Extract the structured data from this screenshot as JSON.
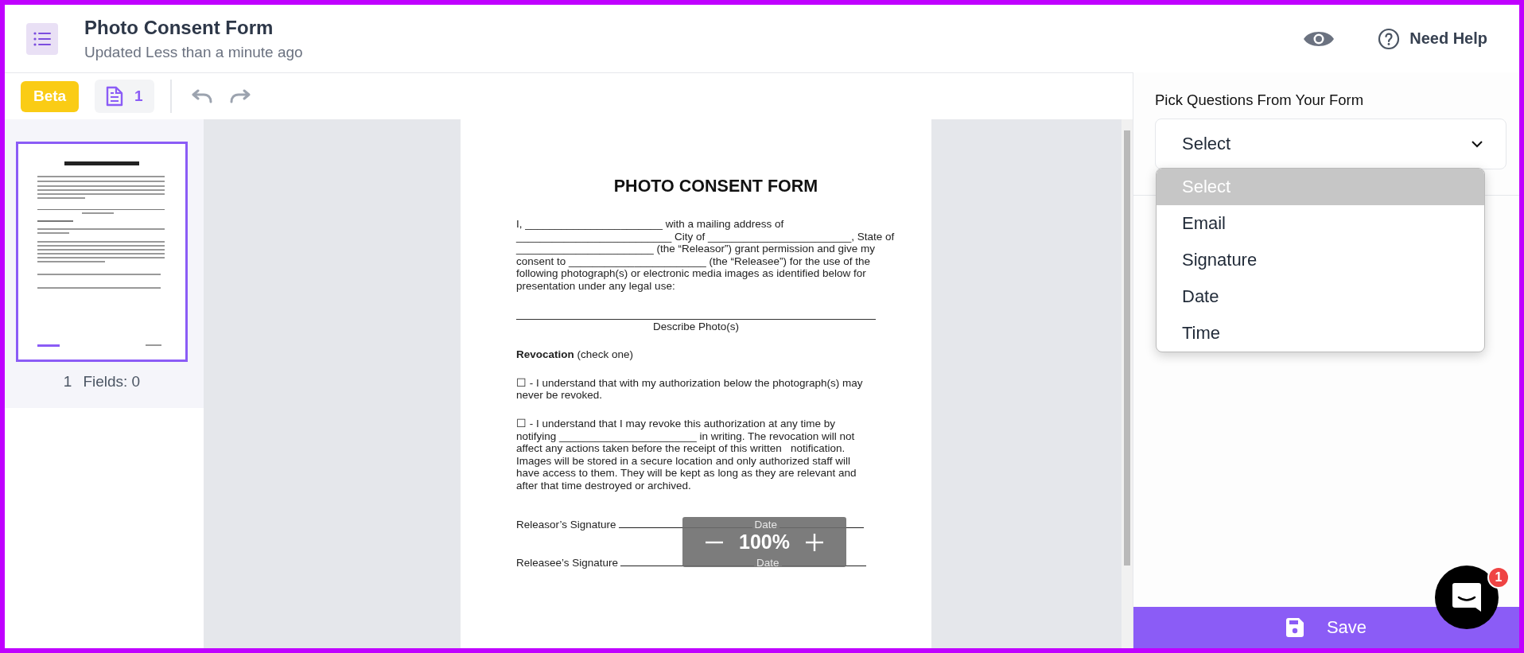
{
  "header": {
    "title": "Photo Consent Form",
    "subtitle": "Updated Less than a minute ago",
    "help_label": "Need Help"
  },
  "toolbar": {
    "beta_label": "Beta",
    "page_count": "1"
  },
  "thumbnails": [
    {
      "page_number": "1",
      "fields_label": "Fields: 0",
      "selected": true
    }
  ],
  "document": {
    "title": "PHOTO CONSENT FORM",
    "blocks": [
      {
        "kind": "paragraph",
        "lines": [
          "I, _______________________ with a mailing address of",
          "__________________________ City of ________________________, State of",
          "_______________________ (the “Releasor”) grant permission and give my",
          "consent to _______________________ (the “Releasee”) for the use of the",
          "following photograph(s) or electronic media images as identified below for",
          "presentation under any legal use:"
        ]
      },
      {
        "kind": "rule",
        "lines": [
          "Describe Photo(s)"
        ]
      },
      {
        "kind": "paragraph",
        "lines": [
          "**Revocation** (check one)"
        ]
      },
      {
        "kind": "paragraph",
        "lines": [
          "☐ - I understand that with my authorization below the photograph(s) may",
          "never be revoked."
        ]
      },
      {
        "kind": "paragraph",
        "lines": [
          "☐ - I understand that I may revoke this authorization at any time by",
          "notifying _______________________ in writing. The revocation will not",
          "affect any actions taken before the receipt of this written   notification.",
          "Images will be stored in a secure location and only authorized staff will",
          "have access to them. They will be kept as long as they are relevant and",
          "after that time destroyed or archived."
        ]
      },
      {
        "kind": "signature",
        "label": "Releasor’s Signature",
        "date_label": "Date"
      },
      {
        "kind": "signature",
        "label": "Releasee’s Signature",
        "date_label": "Date"
      }
    ]
  },
  "zoom": {
    "value": "100%"
  },
  "panel": {
    "label": "Pick Questions From Your Form",
    "select": {
      "value": "Select",
      "open": true
    },
    "options": [
      {
        "label": "Select",
        "selected": true
      },
      {
        "label": "Email",
        "selected": false
      },
      {
        "label": "Signature",
        "selected": false
      },
      {
        "label": "Date",
        "selected": false
      },
      {
        "label": "Time",
        "selected": false
      }
    ]
  },
  "save_label": "Save",
  "chat": {
    "badge": "1"
  }
}
